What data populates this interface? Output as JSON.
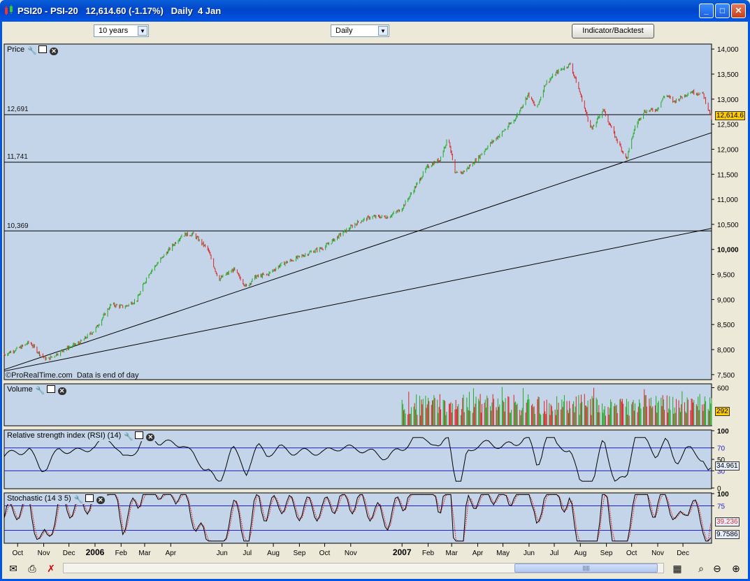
{
  "window": {
    "title": "PSI20 - PSI-20   12,614.60 (-1.17%)   Daily  4 Jan",
    "minimize": "_",
    "maximize": "□",
    "close": "✕"
  },
  "toolbar": {
    "period": "10 years",
    "interval": "Daily",
    "indicator_button": "Indicator/Backtest"
  },
  "panels": {
    "price": "Price",
    "volume": "Volume",
    "rsi": "Relative strength index (RSI) (14)",
    "stoch": "Stochastic (14 3 5)"
  },
  "watermark": "©ProRealTime.com  Data is end of day",
  "badges": {
    "price": "12,614.6",
    "volume": "292",
    "rsi": "34.961",
    "stoch_slow": "39.236",
    "stoch_fast": "9.7586"
  },
  "colors": {
    "background": "#c4d5e9",
    "up": "#22aa22",
    "down": "#dd2222",
    "current": "#ffcc00",
    "stoch_signal": "#dd3333"
  },
  "chart_data": [
    {
      "type": "candlestick",
      "title": "Price",
      "ylim": [
        7400,
        14100
      ],
      "y_ticks": [
        "14,000",
        "13,500",
        "13,000",
        "12,500",
        "12,000",
        "11,500",
        "11,000",
        "10,500",
        "10,000",
        "9,500",
        "9,000",
        "8,500",
        "8,000",
        "7,500"
      ],
      "y_tick_values": [
        14000,
        13500,
        13000,
        12500,
        12000,
        11500,
        11000,
        10500,
        10000,
        9500,
        9000,
        8500,
        8000,
        7500
      ],
      "x_ticks": [
        "Oct",
        "Nov",
        "Dec",
        "2006",
        "Feb",
        "Mar",
        "Apr",
        "Jun",
        "Jul",
        "Aug",
        "Sep",
        "Oct",
        "Nov",
        "2007",
        "Feb",
        "Mar",
        "Apr",
        "May",
        "Jun",
        "Jul",
        "Aug",
        "Sep",
        "Oct",
        "Nov",
        "Dec"
      ],
      "x_tick_dates": [
        "2005-10-01",
        "2005-11-01",
        "2005-12-01",
        "2006-01-01",
        "2006-02-01",
        "2006-03-01",
        "2006-04-01",
        "2006-06-01",
        "2006-07-01",
        "2006-08-01",
        "2006-09-01",
        "2006-10-01",
        "2006-11-01",
        "2007-01-01",
        "2007-02-01",
        "2007-03-01",
        "2007-04-01",
        "2007-05-01",
        "2007-06-01",
        "2007-07-01",
        "2007-08-01",
        "2007-09-01",
        "2007-10-01",
        "2007-11-01",
        "2007-12-01"
      ],
      "close_path": [
        [
          "2005-09-15",
          7900
        ],
        [
          "2005-10-05",
          8050
        ],
        [
          "2005-10-15",
          8150
        ],
        [
          "2005-10-28",
          7900
        ],
        [
          "2005-11-05",
          7800
        ],
        [
          "2005-11-25",
          8000
        ],
        [
          "2005-12-15",
          8150
        ],
        [
          "2006-01-01",
          8400
        ],
        [
          "2006-01-20",
          8900
        ],
        [
          "2006-02-05",
          8850
        ],
        [
          "2006-02-20",
          9000
        ],
        [
          "2006-03-05",
          9500
        ],
        [
          "2006-03-25",
          9900
        ],
        [
          "2006-04-15",
          10300
        ],
        [
          "2006-04-28",
          10300
        ],
        [
          "2006-05-15",
          10000
        ],
        [
          "2006-05-28",
          9400
        ],
        [
          "2006-06-15",
          9600
        ],
        [
          "2006-06-30",
          9250
        ],
        [
          "2006-07-10",
          9450
        ],
        [
          "2006-07-25",
          9500
        ],
        [
          "2006-08-10",
          9700
        ],
        [
          "2006-08-25",
          9800
        ],
        [
          "2006-09-15",
          9950
        ],
        [
          "2006-10-01",
          10050
        ],
        [
          "2006-10-20",
          10300
        ],
        [
          "2006-11-10",
          10550
        ],
        [
          "2006-11-25",
          10650
        ],
        [
          "2006-12-15",
          10650
        ],
        [
          "2006-12-31",
          10800
        ],
        [
          "2007-01-15",
          11200
        ],
        [
          "2007-01-31",
          11650
        ],
        [
          "2007-02-15",
          11800
        ],
        [
          "2007-02-25",
          12250
        ],
        [
          "2007-03-05",
          11500
        ],
        [
          "2007-03-15",
          11550
        ],
        [
          "2007-03-31",
          11800
        ],
        [
          "2007-04-15",
          12100
        ],
        [
          "2007-04-28",
          12300
        ],
        [
          "2007-05-15",
          12600
        ],
        [
          "2007-05-31",
          13100
        ],
        [
          "2007-06-10",
          12800
        ],
        [
          "2007-06-20",
          13300
        ],
        [
          "2007-07-05",
          13550
        ],
        [
          "2007-07-20",
          13700
        ],
        [
          "2007-07-31",
          13150
        ],
        [
          "2007-08-10",
          12600
        ],
        [
          "2007-08-15",
          12400
        ],
        [
          "2007-08-28",
          12800
        ],
        [
          "2007-09-10",
          12300
        ],
        [
          "2007-09-25",
          11800
        ],
        [
          "2007-10-05",
          12450
        ],
        [
          "2007-10-15",
          12750
        ],
        [
          "2007-10-31",
          12800
        ],
        [
          "2007-11-10",
          13100
        ],
        [
          "2007-11-20",
          12950
        ],
        [
          "2007-11-30",
          13050
        ],
        [
          "2007-12-10",
          13150
        ],
        [
          "2007-12-25",
          13100
        ],
        [
          "2008-01-04",
          12614.6
        ]
      ],
      "hlines": [
        {
          "value": 12691,
          "label": "12,691"
        },
        {
          "value": 11741,
          "label": "11,741"
        },
        {
          "value": 10369,
          "label": "10,369"
        }
      ],
      "trendlines": [
        {
          "from": [
            "2005-09-15",
            7600
          ],
          "to": [
            "2008-01-04",
            12330
          ]
        },
        {
          "from": [
            "2005-09-15",
            7570
          ],
          "to": [
            "2008-01-04",
            10420
          ]
        }
      ],
      "current": 12614.6
    },
    {
      "type": "bar",
      "title": "Volume",
      "y_ticks": [
        "600"
      ],
      "y_tick_values": [
        600
      ],
      "start": "2007-01-01",
      "end": "2008-01-04",
      "typical_range": [
        150,
        500
      ],
      "max": 620,
      "current": 292
    },
    {
      "type": "line",
      "title": "Relative strength index (RSI) (14)",
      "ylim": [
        0,
        100
      ],
      "y_ticks": [
        "100",
        "70",
        "50",
        "30",
        "0"
      ],
      "y_tick_values": [
        100,
        70,
        50,
        30,
        0
      ],
      "levels": [
        70,
        30
      ],
      "current": 34.961
    },
    {
      "type": "line",
      "title": "Stochastic (14 3 5)",
      "ylim": [
        0,
        100
      ],
      "y_ticks": [
        "100",
        "75"
      ],
      "y_tick_values": [
        100,
        75
      ],
      "levels": [
        75,
        25
      ],
      "series": [
        {
          "value": 39.236
        },
        {
          "value": 9.7586
        }
      ]
    }
  ],
  "statusbar": {
    "scroll_grip": "|||||"
  }
}
